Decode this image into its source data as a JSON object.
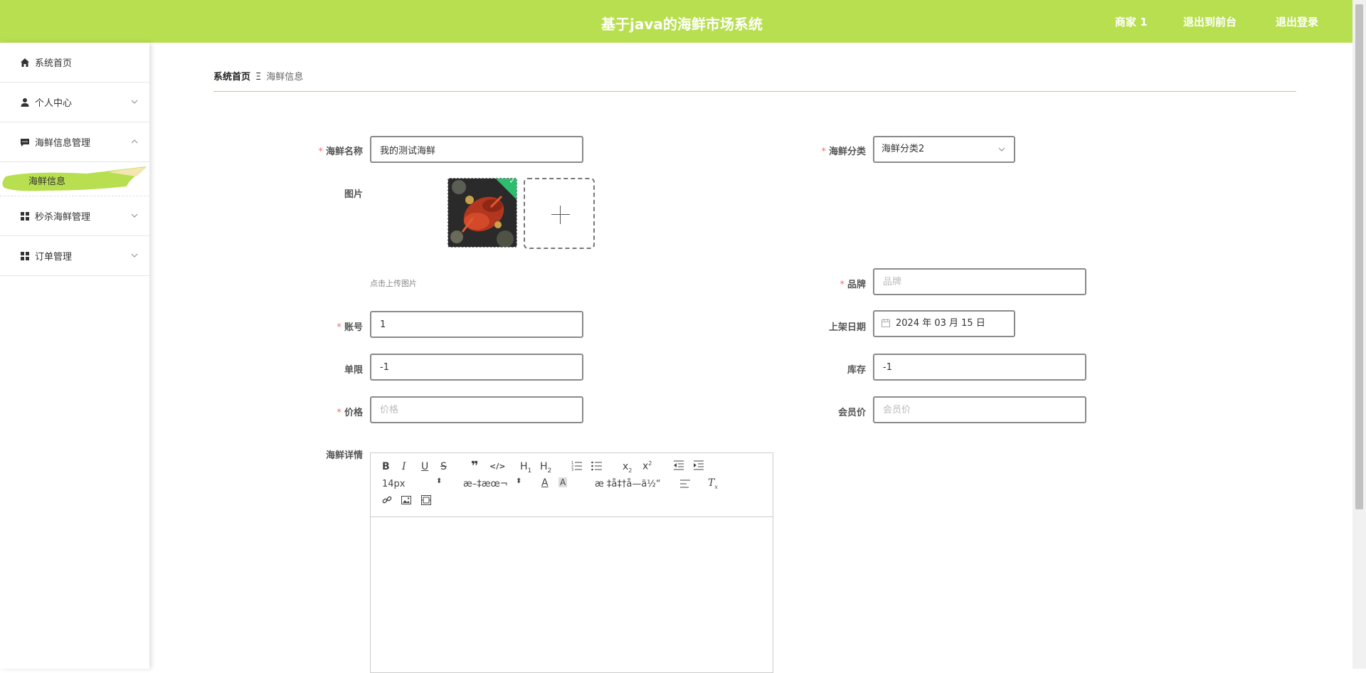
{
  "header": {
    "title": "基于java的海鲜市场系统",
    "user": "商家 1",
    "to_frontend": "退出到前台",
    "logout": "退出登录"
  },
  "sidebar": {
    "items": [
      {
        "label": "系统首页",
        "icon": "home-icon"
      },
      {
        "label": "个人中心",
        "icon": "user-icon"
      },
      {
        "label": "海鲜信息管理",
        "icon": "message-icon"
      },
      {
        "label": "秒杀海鲜管理",
        "icon": "grid-icon"
      },
      {
        "label": "订单管理",
        "icon": "grid-icon"
      }
    ],
    "active_sub": "海鲜信息",
    "active_color": "#b8df4f"
  },
  "breadcrumb": {
    "home": "系统首页",
    "separator": "Ξ",
    "current": "海鲜信息"
  },
  "form": {
    "name": {
      "label": "海鲜名称",
      "value": "我的测试海鲜"
    },
    "category": {
      "label": "海鲜分类",
      "value": "海鲜分类2"
    },
    "image": {
      "label": "图片",
      "hint": "点击上传图片"
    },
    "brand": {
      "label": "品牌",
      "placeholder": "品牌"
    },
    "account": {
      "label": "账号",
      "value": "1"
    },
    "date": {
      "label": "上架日期",
      "value": "2024 年 03 月 15 日"
    },
    "limit": {
      "label": "单限",
      "value": "-1"
    },
    "stock": {
      "label": "库存",
      "value": "-1"
    },
    "price": {
      "label": "价格",
      "placeholder": "价格"
    },
    "member_price": {
      "label": "会员价",
      "placeholder": "会员价"
    },
    "detail": {
      "label": "海鲜详情"
    }
  },
  "editor": {
    "font_size": "14px",
    "font_family": "æ–‡æœ¬",
    "header_select": "æ ‡å‡†å­—ä½“"
  },
  "colors": {
    "accent": "#b8df4f",
    "required": "#f56c6c"
  }
}
